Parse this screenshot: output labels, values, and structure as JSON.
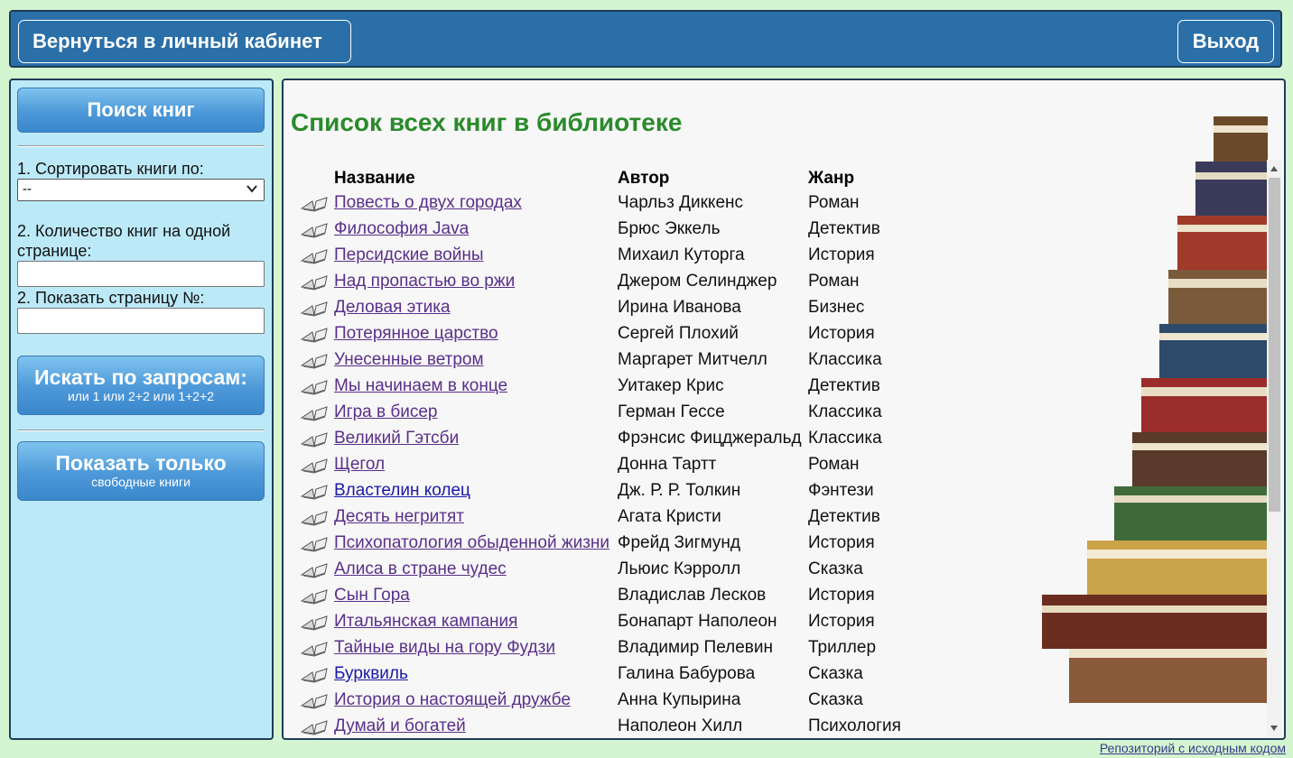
{
  "header": {
    "back_label": "Вернуться в личный кабинет",
    "exit_label": "Выход"
  },
  "sidebar": {
    "search_button": "Поиск книг",
    "sort_label": "1. Сортировать книги по:",
    "sort_selected": "--",
    "per_page_label": "2. Количество книг на одной странице:",
    "page_label": "2. Показать страницу №:",
    "query_button": {
      "title": "Искать по запросам:",
      "subtitle": "или 1 или 2+2 или 1+2+2"
    },
    "free_button": {
      "title": "Показать только",
      "subtitle": "свободные книги"
    }
  },
  "main": {
    "title": "Список всех книг в библиотеке",
    "columns": {
      "title": "Название",
      "author": "Автор",
      "genre": "Жанр"
    },
    "rows": [
      {
        "title": "Повесть о двух городах",
        "author": "Чарльз Диккенс",
        "genre": "Роман",
        "visited": true
      },
      {
        "title": "Философия Java",
        "author": "Брюс Эккель",
        "genre": "Детектив",
        "visited": true
      },
      {
        "title": "Персидские войны",
        "author": "Михаил Куторга",
        "genre": "История",
        "visited": true
      },
      {
        "title": "Над пропастью во ржи",
        "author": "Джером Селинджер",
        "genre": "Роман",
        "visited": true
      },
      {
        "title": "Деловая этика",
        "author": "Ирина Иванова",
        "genre": "Бизнес",
        "visited": true
      },
      {
        "title": "Потерянное царство",
        "author": "Сергей Плохий",
        "genre": "История",
        "visited": true
      },
      {
        "title": "Унесенные ветром",
        "author": "Маргарет Митчелл",
        "genre": "Классика",
        "visited": true
      },
      {
        "title": "Мы начинаем в конце",
        "author": "Уитакер Крис",
        "genre": "Детектив",
        "visited": true
      },
      {
        "title": "Игра в бисер",
        "author": "Герман Гессе",
        "genre": "Классика",
        "visited": true
      },
      {
        "title": "Великий Гэтсби",
        "author": "Фрэнсис Фицджеральд",
        "genre": "Классика",
        "visited": true
      },
      {
        "title": "Щегол",
        "author": "Донна Тартт",
        "genre": "Роман",
        "visited": true
      },
      {
        "title": "Властелин колец",
        "author": "Дж. Р. Р. Толкин",
        "genre": "Фэнтези",
        "visited": false
      },
      {
        "title": "Десять негритят",
        "author": "Агата Кристи",
        "genre": "Детектив",
        "visited": true
      },
      {
        "title": "Психопатология обыденной жизни",
        "author": "Фрейд Зигмунд",
        "genre": "История",
        "visited": true
      },
      {
        "title": "Алиса в стране чудес",
        "author": "Льюис Кэрролл",
        "genre": "Сказка",
        "visited": true
      },
      {
        "title": "Сын Гора",
        "author": "Владислав Лесков",
        "genre": "История",
        "visited": true
      },
      {
        "title": "Итальянская кампания",
        "author": "Бонапарт Наполеон",
        "genre": "История",
        "visited": true
      },
      {
        "title": "Тайные виды на гору Фудзи",
        "author": "Владимир Пелевин",
        "genre": "Триллер",
        "visited": true
      },
      {
        "title": "Бурквиль",
        "author": "Галина Бабурова",
        "genre": "Сказка",
        "visited": false
      },
      {
        "title": "История о настоящей дружбе",
        "author": "Анна Купырина",
        "genre": "Сказка",
        "visited": true
      },
      {
        "title": "Думай и богатей",
        "author": "Наполеон Хилл",
        "genre": "Психология",
        "visited": true
      }
    ]
  },
  "footer": {
    "repo_link": "Репозиторий с исходным кодом"
  },
  "colors": {
    "page_bg": "#d3f5d0",
    "header_bg": "#2b6fa8",
    "sidebar_bg": "#bce9f8",
    "title_green": "#2b8a2b",
    "visited_link": "#5a2f8a",
    "unvisited_link": "#1a1aa6"
  },
  "icons": {
    "row_icon": "open-book-icon",
    "sort_dropdown": "chevron-down-icon"
  }
}
